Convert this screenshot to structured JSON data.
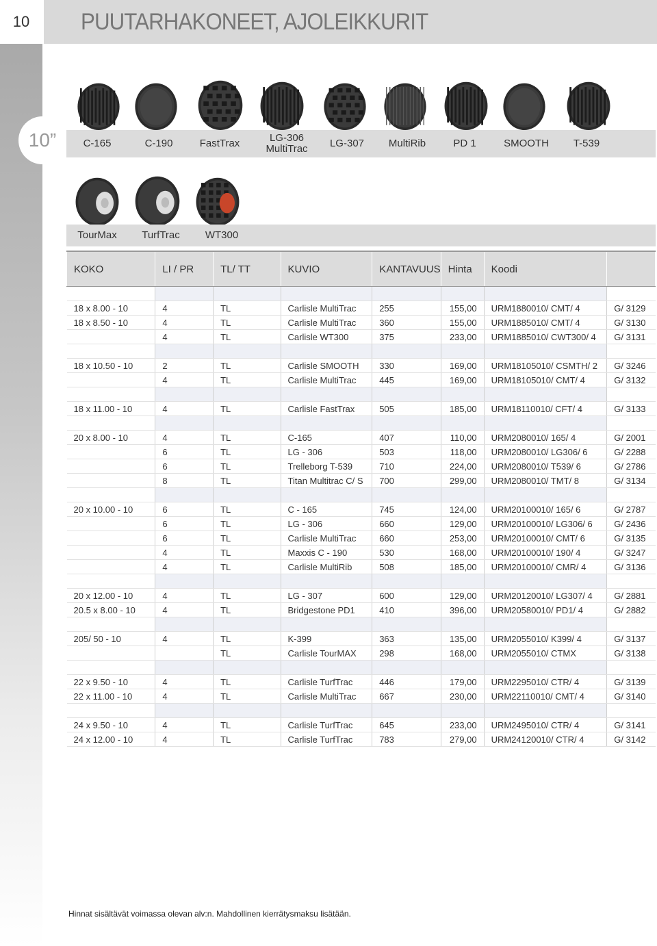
{
  "page": {
    "number": "10",
    "title": "PUUTARHAKONEET, AJOLEIKKURIT",
    "size_badge": "10”"
  },
  "tires_row1": [
    "C-165",
    "C-190",
    "FastTrax",
    "LG-306\nMultiTrac",
    "LG-307",
    "MultiRib",
    "PD 1",
    "SMOOTH",
    "T-539"
  ],
  "tires_row2": [
    "TourMax",
    "TurfTrac",
    "WT300"
  ],
  "table": {
    "headers": [
      "KOKO",
      "LI / PR",
      "TL/ TT",
      "KUVIO",
      "KANTAVUUS",
      "Hinta",
      "Koodi",
      ""
    ],
    "groups": [
      {
        "rows": [
          [
            "18 x 8.00 - 10",
            "4",
            "TL",
            "Carlisle MultiTrac",
            "255",
            "155,00",
            "URM1880010/ CMT/ 4",
            "G/ 3129"
          ],
          [
            "18 x 8.50 - 10",
            "4",
            "TL",
            "Carlisle MultiTrac",
            "360",
            "155,00",
            "URM1885010/ CMT/ 4",
            "G/ 3130"
          ],
          [
            "",
            "4",
            "TL",
            "Carlisle WT300",
            "375",
            "233,00",
            "URM1885010/ CWT300/ 4",
            "G/ 3131"
          ]
        ]
      },
      {
        "rows": [
          [
            "18 x 10.50 - 10",
            "2",
            "TL",
            "Carlisle SMOOTH",
            "330",
            "169,00",
            "URM18105010/ CSMTH/ 2",
            "G/ 3246"
          ],
          [
            "",
            "4",
            "TL",
            "Carlisle MultiTrac",
            "445",
            "169,00",
            "URM18105010/ CMT/ 4",
            "G/ 3132"
          ]
        ]
      },
      {
        "rows": [
          [
            "18 x 11.00 - 10",
            "4",
            "TL",
            "Carlisle FastTrax",
            "505",
            "185,00",
            "URM18110010/ CFT/ 4",
            "G/ 3133"
          ]
        ]
      },
      {
        "rows": [
          [
            "20 x 8.00 - 10",
            "4",
            "TL",
            "C-165",
            "407",
            "110,00",
            "URM2080010/ 165/ 4",
            "G/ 2001"
          ],
          [
            "",
            "6",
            "TL",
            "LG - 306",
            "503",
            "118,00",
            "URM2080010/ LG306/ 6",
            "G/ 2288"
          ],
          [
            "",
            "6",
            "TL",
            "Trelleborg T-539",
            "710",
            "224,00",
            "URM2080010/ T539/ 6",
            "G/ 2786"
          ],
          [
            "",
            "8",
            "TL",
            "Titan Multitrac C/ S",
            "700",
            "299,00",
            "URM2080010/ TMT/ 8",
            "G/ 3134"
          ]
        ]
      },
      {
        "rows": [
          [
            "20 x 10.00 - 10",
            "6",
            "TL",
            "C - 165",
            "745",
            "124,00",
            "URM20100010/ 165/ 6",
            "G/ 2787"
          ],
          [
            "",
            "6",
            "TL",
            "LG - 306",
            "660",
            "129,00",
            "URM20100010/ LG306/ 6",
            "G/ 2436"
          ],
          [
            "",
            "6",
            "TL",
            "Carlisle MultiTrac",
            "660",
            "253,00",
            "URM20100010/ CMT/ 6",
            "G/ 3135"
          ],
          [
            "",
            "4",
            "TL",
            "Maxxis C - 190",
            "530",
            "168,00",
            "URM20100010/ 190/ 4",
            "G/ 3247"
          ],
          [
            "",
            "4",
            "TL",
            "Carlisle MultiRib",
            "508",
            "185,00",
            "URM20100010/ CMR/ 4",
            "G/ 3136"
          ]
        ]
      },
      {
        "rows": [
          [
            "20 x 12.00 - 10",
            "4",
            "TL",
            "LG - 307",
            "600",
            "129,00",
            "URM20120010/ LG307/ 4",
            "G/ 2881"
          ],
          [
            "20.5 x 8.00 - 10",
            "4",
            "TL",
            "Bridgestone PD1",
            "410",
            "396,00",
            "URM20580010/ PD1/ 4",
            "G/ 2882"
          ]
        ]
      },
      {
        "rows": [
          [
            "205/ 50 - 10",
            "4",
            "TL",
            "K-399",
            "363",
            "135,00",
            "URM2055010/ K399/ 4",
            "G/ 3137"
          ],
          [
            "",
            "",
            "TL",
            "Carlisle TourMAX",
            "298",
            "168,00",
            "URM2055010/ CTMX",
            "G/ 3138"
          ]
        ]
      },
      {
        "rows": [
          [
            "22 x 9.50 - 10",
            "4",
            "TL",
            "Carlisle TurfTrac",
            "446",
            "179,00",
            "URM2295010/ CTR/ 4",
            "G/ 3139"
          ],
          [
            "22 x 11.00 - 10",
            "4",
            "TL",
            "Carlisle MultiTrac",
            "667",
            "230,00",
            "URM22110010/ CMT/ 4",
            "G/ 3140"
          ]
        ]
      },
      {
        "rows": [
          [
            "24 x 9.50 - 10",
            "4",
            "TL",
            "Carlisle TurfTrac",
            "645",
            "233,00",
            "URM2495010/ CTR/ 4",
            "G/ 3141"
          ],
          [
            "24 x 12.00 - 10",
            "4",
            "TL",
            "Carlisle TurfTrac",
            "783",
            "279,00",
            "URM24120010/ CTR/ 4",
            "G/ 3142"
          ]
        ]
      }
    ]
  },
  "footer": "Hinnat sisältävät voimassa olevan alv:n. Mahdollinen kierrätysmaksu lisätään."
}
